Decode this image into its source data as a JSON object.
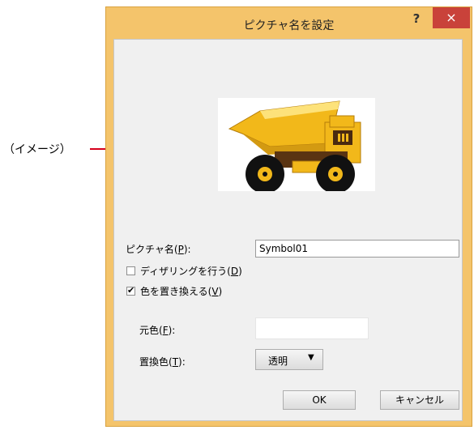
{
  "callout": {
    "label": "（イメージ）"
  },
  "dialog": {
    "title": "ピクチャ名を設定",
    "help_label": "?",
    "close_label": "×",
    "picture_name": {
      "label": "ピクチャ名(",
      "key": "P",
      "suffix": "):",
      "value": "Symbol01"
    },
    "dithering": {
      "label": "ディザリングを行う(",
      "key": "D",
      "suffix": ")",
      "checked": false
    },
    "replace_color": {
      "label": "色を置き換える(",
      "key": "V",
      "suffix": ")",
      "checked": true
    },
    "source_color": {
      "label": "元色(",
      "key": "F",
      "suffix": "):"
    },
    "replacement_color": {
      "label": "置換色(",
      "key": "T",
      "suffix": "):",
      "value": "透明"
    },
    "ok_label": "OK",
    "cancel_label": "キャンセル"
  }
}
